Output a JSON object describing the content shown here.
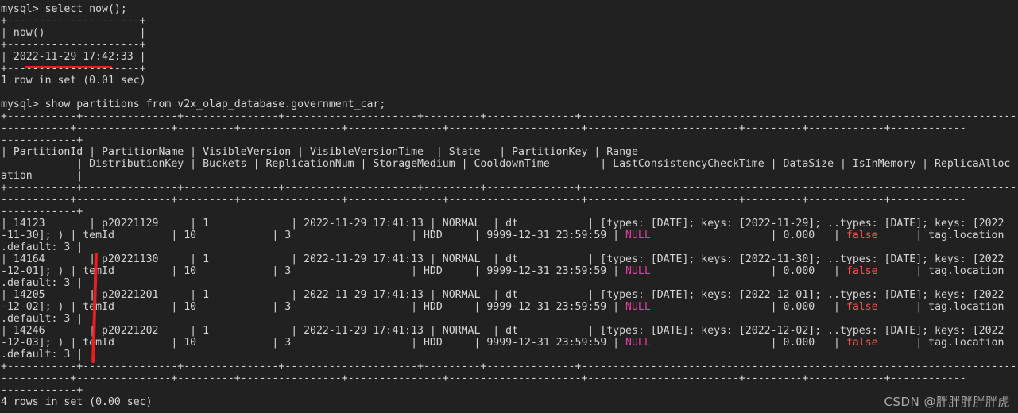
{
  "terminal": {
    "background": "#212121",
    "foreground": "#d6d6d6",
    "null_color": "#e03fa0",
    "false_color": "#f05a55",
    "annotation_color": "#f21b1b"
  },
  "session": {
    "prompt": "mysql> ",
    "query1": {
      "command": "mysql> select now();",
      "border_top": "+---------------------+",
      "header": "| now()               |",
      "border_mid": "+---------------------+",
      "row": "| 2022-11-29 17:42:33 |",
      "border_bottom": "+---------------------+",
      "result": "1 row in set (0.01 sec)",
      "value": "2022-11-29 17:42:33"
    },
    "query2": {
      "command": "mysql> show partitions from v2x_olap_database.government_car;",
      "border_a1": "+-----------+---------------+---------------+---------------------+---------+--------------+---------------------------------------------------------------------------------------------------------------",
      "border_a2": "-----------+---------------+---------+----------------+---------------+---------------------+------------------------+---------+------------+------------",
      "border_a3": "------------+",
      "header_1": "| PartitionId | PartitionName | VisibleVersion | VisibleVersionTime  | State   | PartitionKey | Range",
      "header_2": "            | DistributionKey | Buckets | ReplicationNum | StorageMedium | CooldownTime        | LastConsistencyCheckTime | DataSize | IsInMemory | ReplicaAlloc",
      "header_3": "ation       |",
      "border_b1": "+-----------+---------------+---------------+---------------------+---------+--------------+---------------------------------------------------------------------------------------------------------------",
      "border_b2": "-----------+---------------+---------+----------------+---------------+---------------------+------------------------+---------+------------+------------",
      "border_b3": "------------+",
      "footer_1": "+-----------+---------------+---------------+---------------------+---------+--------------+---------------------------------------------------------------------------------------------------------------",
      "footer_2": "-----------+---------------+---------+----------------+---------------+---------------------+------------------------+---------+------------+------------",
      "footer_3": "------------+",
      "result": "4 rows in set (0.00 sec)",
      "columns": [
        "PartitionId",
        "PartitionName",
        "VisibleVersion",
        "VisibleVersionTime",
        "State",
        "PartitionKey",
        "Range",
        "DistributionKey",
        "Buckets",
        "ReplicationNum",
        "StorageMedium",
        "CooldownTime",
        "LastConsistencyCheckTime",
        "DataSize",
        "IsInMemory",
        "ReplicaAlloc"
      ],
      "rows": [
        {
          "line_a_pre": "| 14123       | p20221129     | 1             | 2022-11-29 17:41:13 | NORMAL  | dt           | [types: [DATE]; keys: [2022-11-29]; ..types: [DATE]; keys: [2022",
          "line_b_pre": "-11-30]; ) | temId         | 10            | 3                   | HDD     | 9999-12-31 23:59:59 | ",
          "line_b_null": "NULL",
          "line_b_mid": "                   | 0.000   | ",
          "line_b_false": "false",
          "line_b_post": "      | tag.location",
          "line_c": ".default: 3 |",
          "partition_id": "14123",
          "partition_name": "p20221129",
          "visible_version": "1",
          "visible_version_time": "2022-11-29 17:41:13",
          "state": "NORMAL",
          "partition_key": "dt",
          "range": "[types: [DATE]; keys: [2022-11-29]; ..types: [DATE]; keys: [2022-11-30]; )",
          "distribution_key": "temId",
          "buckets": "10",
          "replication_num": "3",
          "storage_medium": "HDD",
          "cooldown_time": "9999-12-31 23:59:59",
          "last_consistency_check_time": "NULL",
          "data_size": "0.000",
          "is_in_memory": "false",
          "replica_alloc": "tag.location.default: 3"
        },
        {
          "line_a_pre": "| 14164       | p20221130     | 1             | 2022-11-29 17:41:13 | NORMAL  | dt           | [types: [DATE]; keys: [2022-11-30]; ..types: [DATE]; keys: [2022",
          "line_b_pre": "-12-01]; ) | temId         | 10            | 3                   | HDD     | 9999-12-31 23:59:59 | ",
          "line_b_null": "NULL",
          "line_b_mid": "                   | 0.000   | ",
          "line_b_false": "false",
          "line_b_post": "      | tag.location",
          "line_c": ".default: 3 |",
          "partition_id": "14164",
          "partition_name": "p20221130",
          "visible_version": "1",
          "visible_version_time": "2022-11-29 17:41:13",
          "state": "NORMAL",
          "partition_key": "dt",
          "range": "[types: [DATE]; keys: [2022-11-30]; ..types: [DATE]; keys: [2022-12-01]; )",
          "distribution_key": "temId",
          "buckets": "10",
          "replication_num": "3",
          "storage_medium": "HDD",
          "cooldown_time": "9999-12-31 23:59:59",
          "last_consistency_check_time": "NULL",
          "data_size": "0.000",
          "is_in_memory": "false",
          "replica_alloc": "tag.location.default: 3"
        },
        {
          "line_a_pre": "| 14205       | p20221201     | 1             | 2022-11-29 17:41:13 | NORMAL  | dt           | [types: [DATE]; keys: [2022-12-01]; ..types: [DATE]; keys: [2022",
          "line_b_pre": "-12-02]; ) | temId         | 10            | 3                   | HDD     | 9999-12-31 23:59:59 | ",
          "line_b_null": "NULL",
          "line_b_mid": "                   | 0.000   | ",
          "line_b_false": "false",
          "line_b_post": "      | tag.location",
          "line_c": ".default: 3 |",
          "partition_id": "14205",
          "partition_name": "p20221201",
          "visible_version": "1",
          "visible_version_time": "2022-11-29 17:41:13",
          "state": "NORMAL",
          "partition_key": "dt",
          "range": "[types: [DATE]; keys: [2022-12-01]; ..types: [DATE]; keys: [2022-12-02]; )",
          "distribution_key": "temId",
          "buckets": "10",
          "replication_num": "3",
          "storage_medium": "HDD",
          "cooldown_time": "9999-12-31 23:59:59",
          "last_consistency_check_time": "NULL",
          "data_size": "0.000",
          "is_in_memory": "false",
          "replica_alloc": "tag.location.default: 3"
        },
        {
          "line_a_pre": "| 14246       | p20221202     | 1             | 2022-11-29 17:41:13 | NORMAL  | dt           | [types: [DATE]; keys: [2022-12-02]; ..types: [DATE]; keys: [2022",
          "line_b_pre": "-12-03]; ) | temId         | 10            | 3                   | HDD     | 9999-12-31 23:59:59 | ",
          "line_b_null": "NULL",
          "line_b_mid": "                   | 0.000   | ",
          "line_b_false": "false",
          "line_b_post": "      | tag.location",
          "line_c": ".default: 3 |",
          "partition_id": "14246",
          "partition_name": "p20221202",
          "visible_version": "1",
          "visible_version_time": "2022-11-29 17:41:13",
          "state": "NORMAL",
          "partition_key": "dt",
          "range": "[types: [DATE]; keys: [2022-12-02]; ..types: [DATE]; keys: [2022-12-03]; )",
          "distribution_key": "temId",
          "buckets": "10",
          "replication_num": "3",
          "storage_medium": "HDD",
          "cooldown_time": "9999-12-31 23:59:59",
          "last_consistency_check_time": "NULL",
          "data_size": "0.000",
          "is_in_memory": "false",
          "replica_alloc": "tag.location.default: 3"
        }
      ]
    }
  },
  "annotations": {
    "timestamp_underline": "red-underline-on-now-result",
    "partition_name_vline": "red-vertical-line-beside-partition-names"
  },
  "watermark": {
    "text": "CSDN @胖胖胖胖胖虎"
  }
}
